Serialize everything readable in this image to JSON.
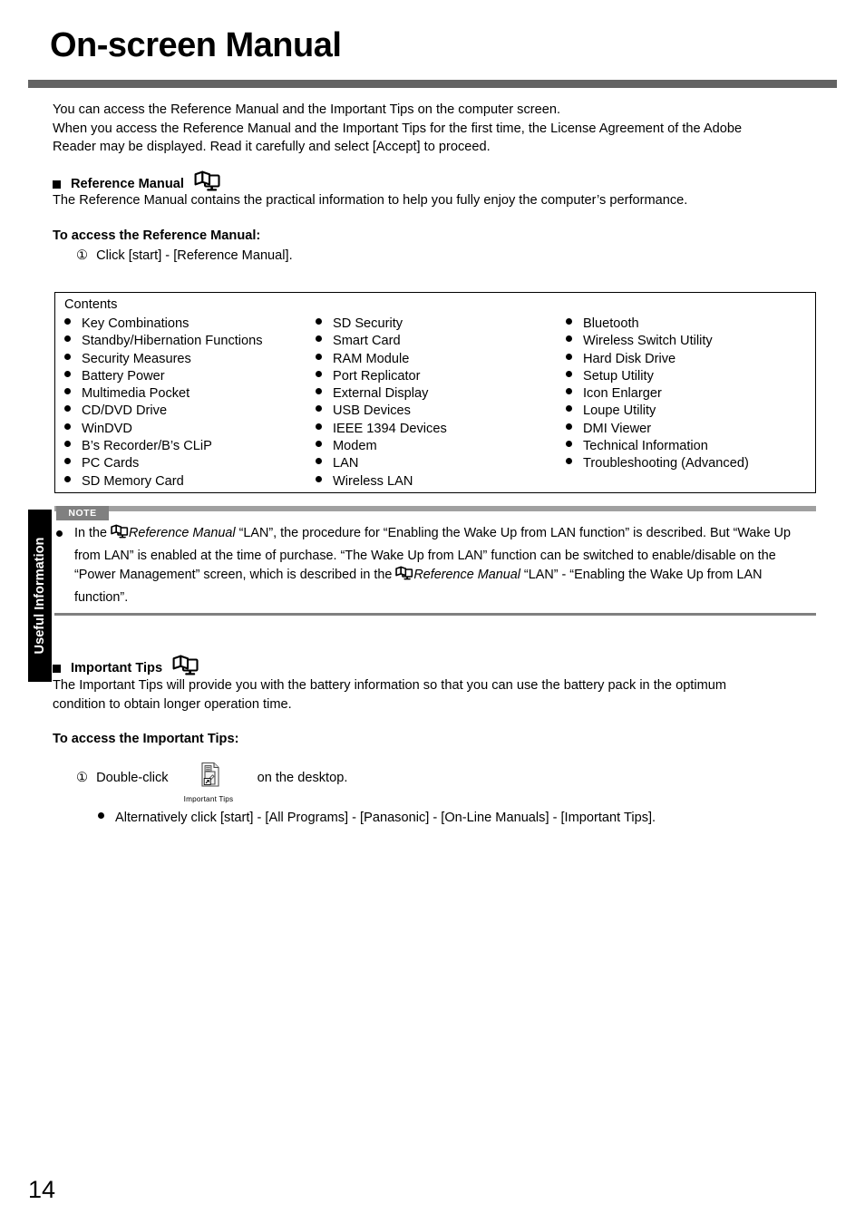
{
  "page": {
    "title": "On-screen Manual",
    "number": "14",
    "side_tab": "Useful Information",
    "rule_color": "#636363"
  },
  "intro": {
    "line1": "You can access the Reference Manual and the Important Tips on the computer screen.",
    "line2": "When you access the Reference Manual and the Important Tips for the first time, the License Agreement of the Adobe",
    "line3": "Reader may be displayed. Read it carefully and select [Accept] to proceed."
  },
  "reference_manual": {
    "heading": "Reference Manual",
    "heading_icon": "book-monitor-icon",
    "description": "The Reference Manual contains the practical information to help you fully enjoy the computer’s performance.",
    "access_heading": "To access the Reference Manual:",
    "step_number": "①",
    "step_text": "Click [start] - [Reference Manual]."
  },
  "contents": {
    "label": "Contents",
    "columns": [
      [
        "Key Combinations",
        "Standby/Hibernation Functions",
        "Security Measures",
        "Battery Power",
        "Multimedia Pocket",
        "CD/DVD Drive",
        "WinDVD",
        "B’s Recorder/B’s CLiP",
        "PC Cards",
        "SD Memory Card"
      ],
      [
        "SD Security",
        "Smart Card",
        "RAM Module",
        "Port Replicator",
        "External Display",
        "USB Devices",
        "IEEE 1394 Devices",
        "Modem",
        "LAN",
        "Wireless LAN"
      ],
      [
        "Bluetooth",
        "Wireless Switch Utility",
        "Hard Disk Drive",
        "Setup Utility",
        "Icon Enlarger",
        "Loupe Utility",
        "DMI Viewer",
        "Technical Information",
        "Troubleshooting (Advanced)"
      ]
    ]
  },
  "note": {
    "badge": "NOTE",
    "bar_color": "#a0a0a0",
    "badge_color": "#808080",
    "t1": "In the ",
    "t2": "Reference Manual",
    "t3": " “LAN”, the procedure for “Enabling the Wake Up from LAN function” is described. But “Wake Up from LAN” is enabled at the time of purchase. “The Wake Up from LAN” function can be switched to enable/disable on the “Power Management” screen, which is described in the ",
    "t4": "Reference Manual",
    "t5": " “LAN” - “Enabling the Wake Up from LAN function”."
  },
  "important_tips": {
    "heading": "Important Tips",
    "heading_icon": "book-monitor-icon",
    "description_line1": "The Important Tips will provide you with the battery information so that you can use the battery pack in the optimum",
    "description_line2": "condition to obtain longer operation time.",
    "access_heading": "To access the Important Tips:",
    "step_number": "①",
    "step_text_before": "Double-click",
    "step_text_after": "on the desktop.",
    "desktop_icon_name": "important-tips-shortcut-icon",
    "desktop_icon_caption": "Important Tips",
    "alt_bullet": "Alternatively click [start] - [All Programs] - [Panasonic] - [On-Line Manuals] - [Important Tips]."
  }
}
